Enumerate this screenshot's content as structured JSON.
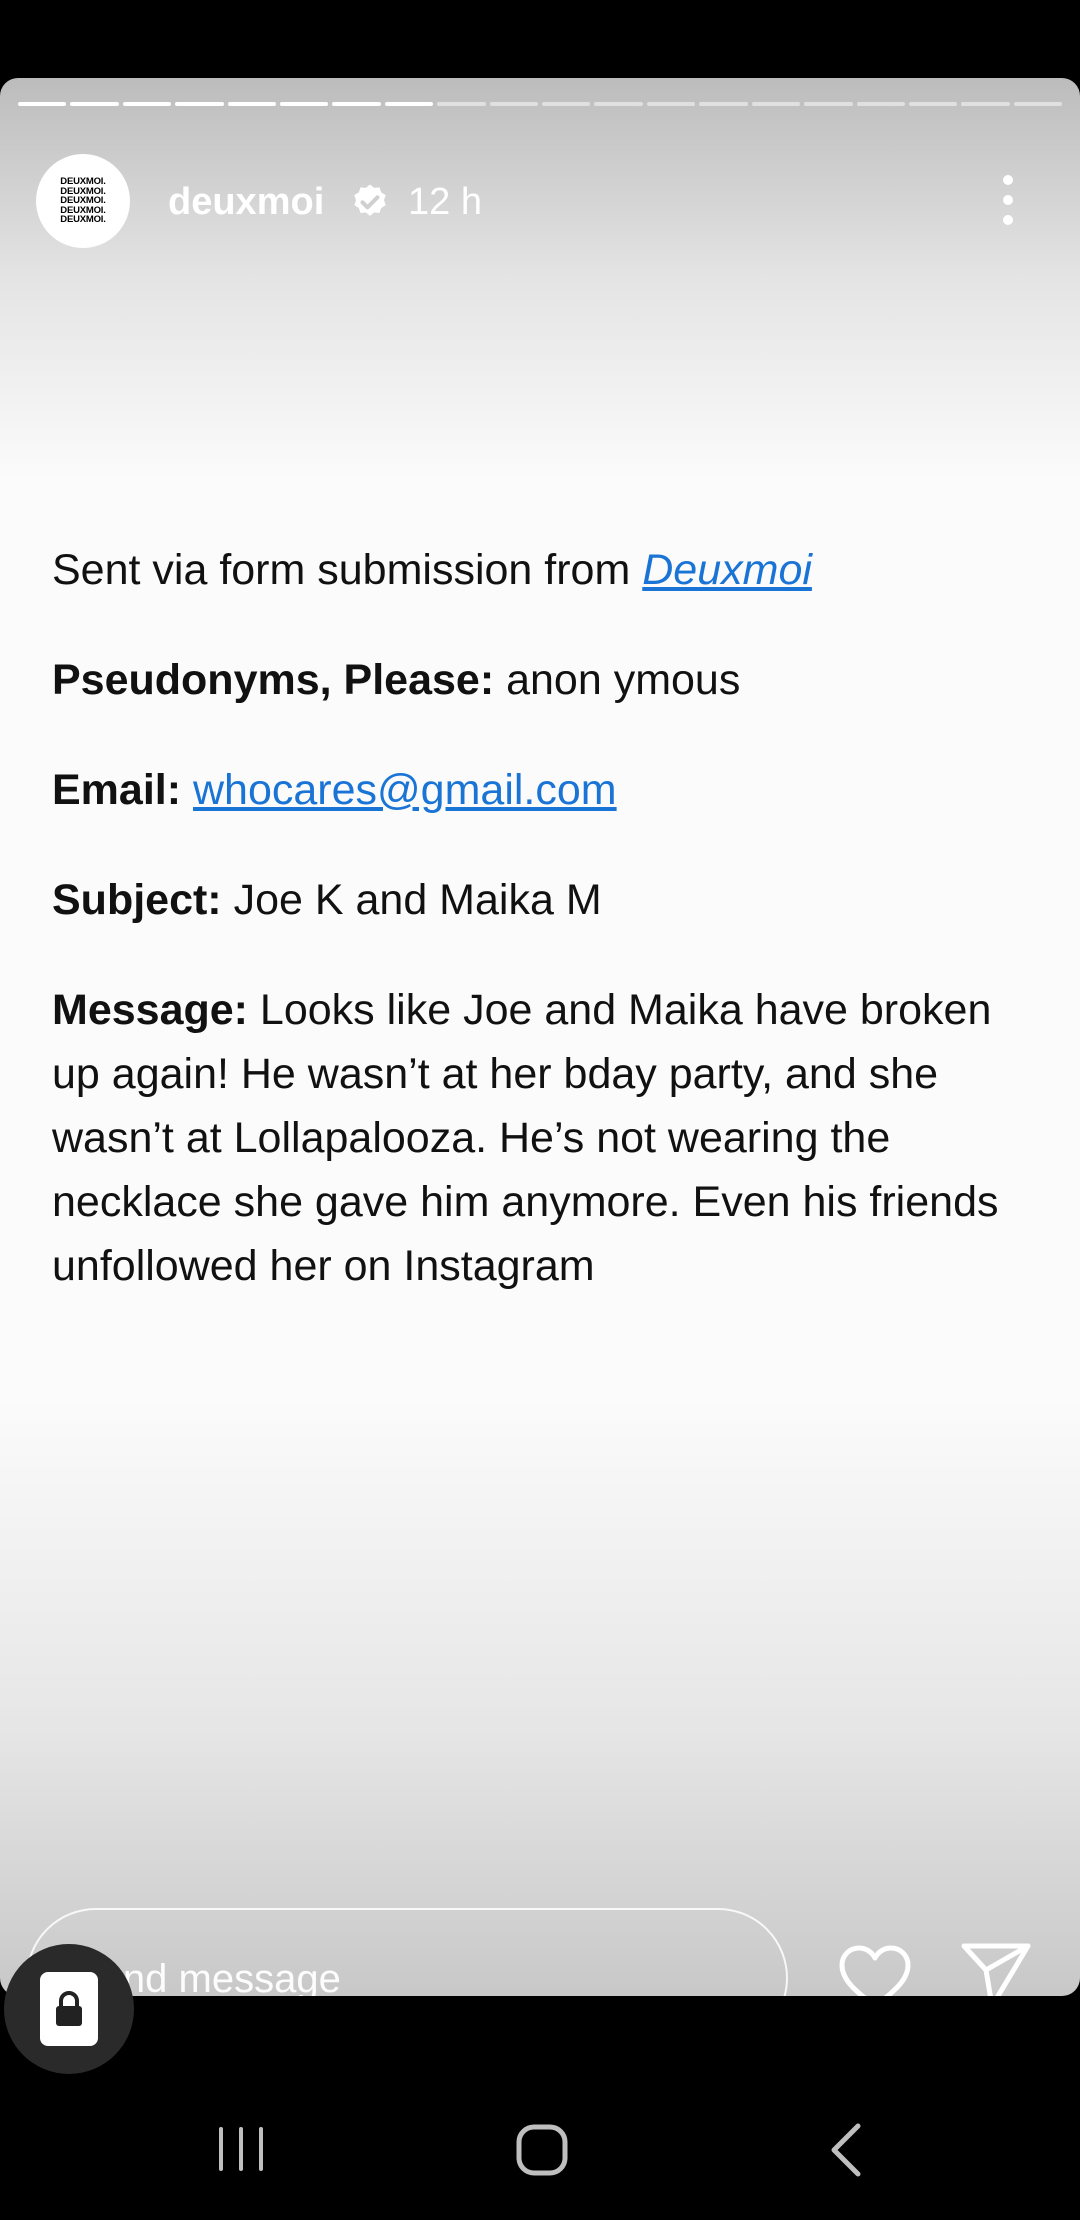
{
  "story": {
    "progress": {
      "segments_total": 20,
      "segments_viewed": 8
    },
    "author": {
      "avatar_text_lines": [
        "DEUXMOI.",
        "DEUXMOI.",
        "DEUXMOI.",
        "DEUXMOI.",
        "DEUXMOI."
      ],
      "username": "deuxmoi",
      "verified_icon": "verified-badge-icon",
      "time_ago": "12 h"
    },
    "more_icon": "more-vertical-icon",
    "content": {
      "intro_text": "Sent via form submission from ",
      "intro_link": "Deuxmoi",
      "pseudonym_label": "Pseudonyms, Please:",
      "pseudonym_value": " anon ymous",
      "email_label": "Email:",
      "email_value": "whocares@gmail.com",
      "subject_label": "Subject:",
      "subject_value": " Joe K and Maika M",
      "message_label": "Message:",
      "message_value": " Looks like Joe and Maika have broken up again! He wasn’t at her bday party, and she wasn’t at Lollapalooza. He’s not wearing the necklace she gave him anymore. Even his friends unfollowed her on Instagram"
    }
  },
  "footer": {
    "message_placeholder": "Send message",
    "heart_icon": "heart-icon",
    "send_icon": "send-icon"
  },
  "overlay": {
    "lock_icon": "lock-icon"
  },
  "navbar": {
    "recent_icon": "recent-apps-icon",
    "home_icon": "home-icon",
    "back_icon": "back-icon"
  },
  "colors": {
    "link": "#1a74d6",
    "text": "#111111",
    "background": "#000000"
  }
}
